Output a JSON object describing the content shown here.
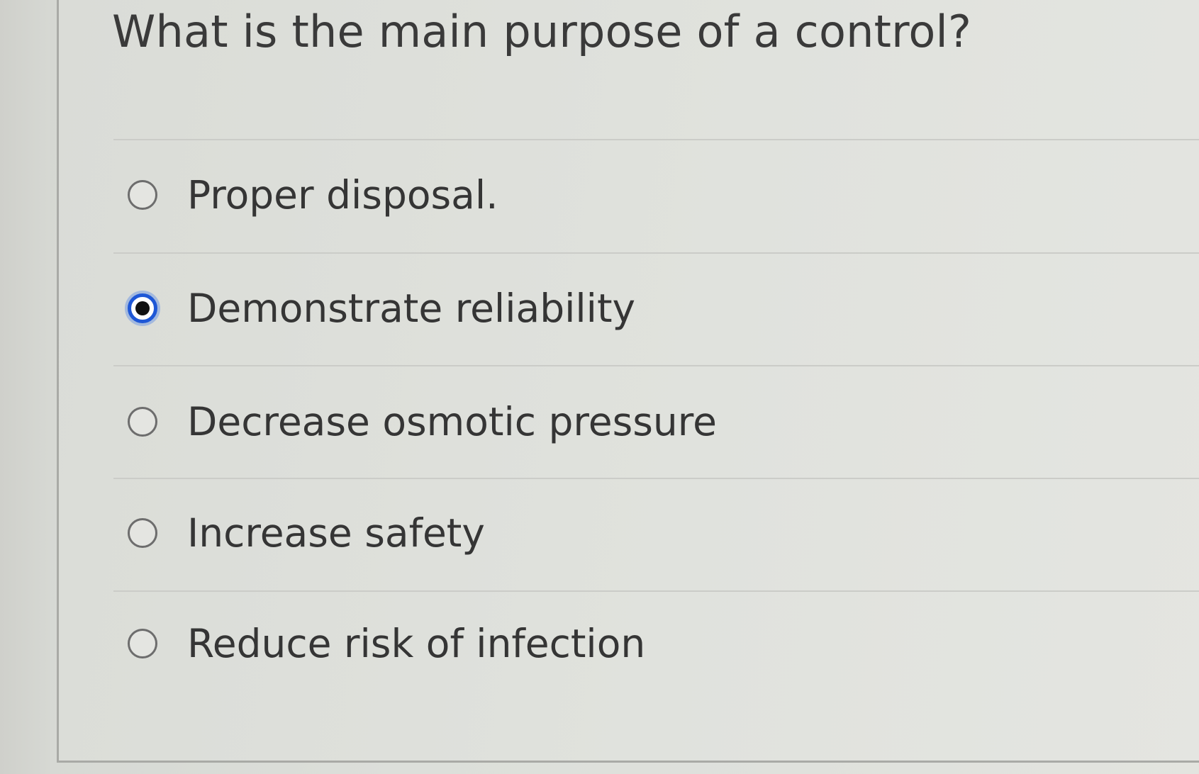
{
  "question": {
    "text": "What is the main purpose of a control?"
  },
  "options": [
    {
      "label": "Proper disposal.",
      "selected": false
    },
    {
      "label": "Demonstrate reliability",
      "selected": true
    },
    {
      "label": "Decrease osmotic pressure",
      "selected": false
    },
    {
      "label": "Increase safety",
      "selected": false
    },
    {
      "label": "Reduce risk of infection",
      "selected": false
    }
  ],
  "colors": {
    "selected_radio": "#1e57d6",
    "text": "#353535",
    "background": "#dfe1dc"
  },
  "icons": {
    "unselected": "radio-unselected-icon",
    "selected": "radio-selected-icon"
  }
}
